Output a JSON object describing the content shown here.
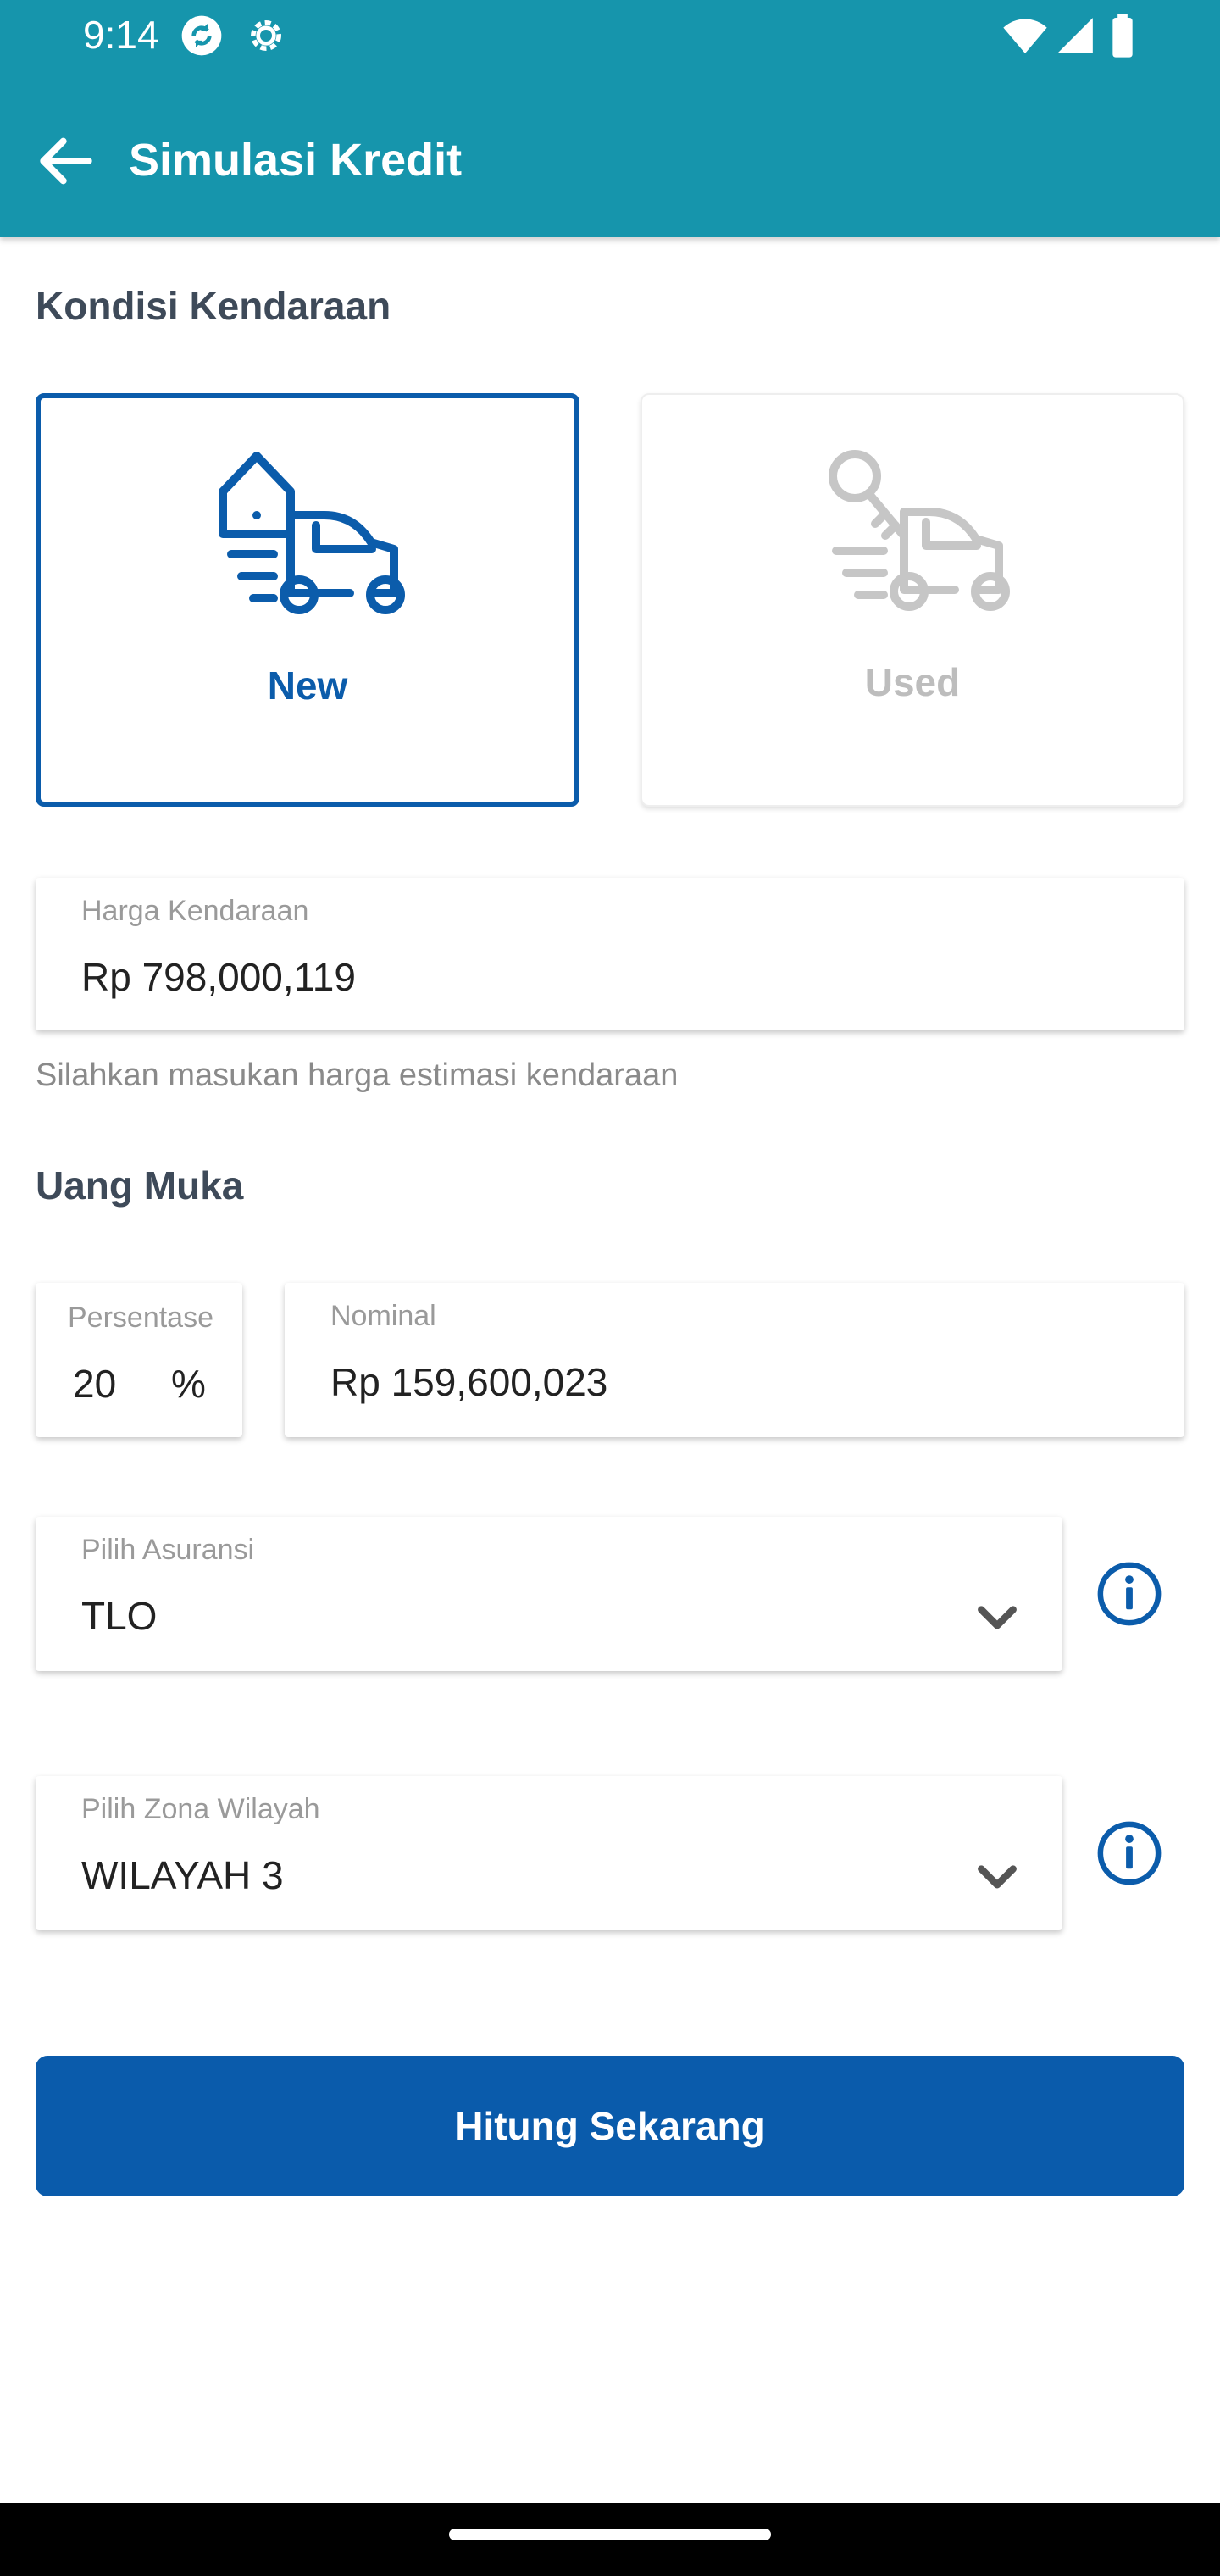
{
  "status_bar": {
    "time": "9:14",
    "icons": [
      "sync-icon",
      "settings-icon",
      "wifi-icon",
      "signal-icon",
      "battery-icon"
    ]
  },
  "app_bar": {
    "title": "Simulasi Kredit",
    "back_icon": "arrow-left-icon"
  },
  "vehicle_condition": {
    "title": "Kondisi Kendaraan",
    "options": [
      {
        "label": "New",
        "selected": true,
        "icon": "new-car-tag-icon"
      },
      {
        "label": "Used",
        "selected": false,
        "icon": "used-car-key-icon"
      }
    ]
  },
  "vehicle_price": {
    "label": "Harga Kendaraan",
    "value": "Rp 798,000,119",
    "helper": "Silahkan masukan harga estimasi kendaraan"
  },
  "down_payment": {
    "title": "Uang Muka",
    "percentage": {
      "label": "Persentase",
      "value": "20",
      "unit": "%"
    },
    "nominal": {
      "label": "Nominal",
      "value": "Rp 159,600,023"
    }
  },
  "insurance": {
    "label": "Pilih Asuransi",
    "value": "TLO"
  },
  "zone": {
    "label": "Pilih Zona Wilayah",
    "value": "WILAYAH 3"
  },
  "cta": {
    "label": "Hitung Sekarang"
  },
  "colors": {
    "app_bar": "#1695ac",
    "primary": "#0a5bab",
    "disabled": "#bdbdbd"
  }
}
